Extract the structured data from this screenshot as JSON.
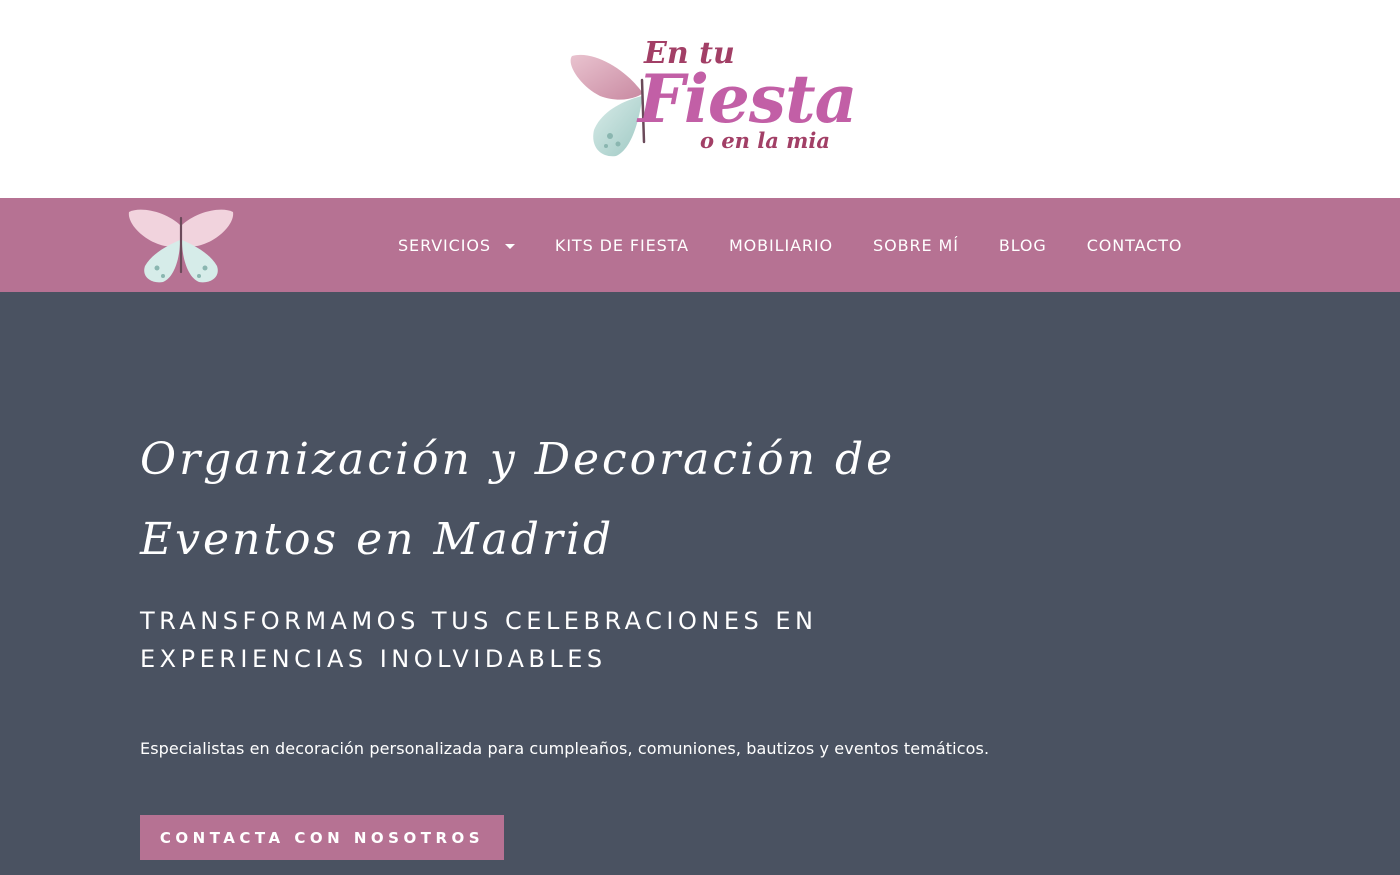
{
  "header": {
    "logo": {
      "icon": "butterfly-icon",
      "line_top": "En tu",
      "line_main": "Fiesta",
      "line_bottom": "o en la mia"
    }
  },
  "nav": {
    "icon": "butterfly-icon",
    "items": [
      {
        "label": "SERVICIOS",
        "has_dropdown": true
      },
      {
        "label": "KITS DE FIESTA"
      },
      {
        "label": "MOBILIARIO"
      },
      {
        "label": "SOBRE MÍ"
      },
      {
        "label": "BLOG"
      },
      {
        "label": "CONTACTO"
      }
    ]
  },
  "hero": {
    "title": "Organización y Decoración de Eventos en Madrid",
    "subtitle": "TRANSFORMAMOS TUS CELEBRACIONES EN EXPERIENCIAS INOLVIDABLES",
    "description": "Especialistas en decoración personalizada para cumpleaños, comuniones, bautizos y eventos temáticos.",
    "cta_label": "CONTACTA CON NOSOTROS"
  },
  "colors": {
    "nav_background": "#b67293",
    "hero_background": "#4a5261",
    "header_background": "#ffffff",
    "text_on_dark": "#ffffff"
  }
}
